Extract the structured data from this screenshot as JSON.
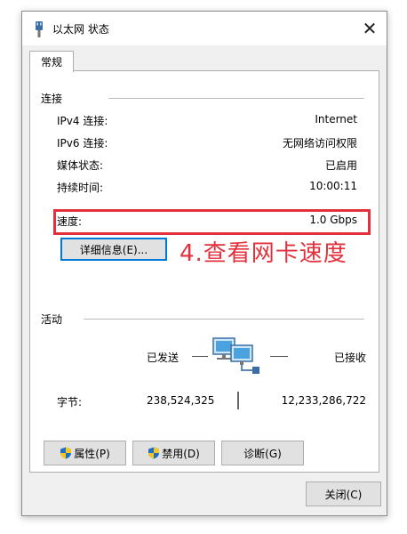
{
  "window": {
    "title": "以太网 状态",
    "close_glyph": "✕"
  },
  "tabs": [
    {
      "label": "常规"
    }
  ],
  "connection": {
    "group_label": "连接",
    "rows": [
      {
        "label": "IPv4 连接:",
        "value": "Internet"
      },
      {
        "label": "IPv6 连接:",
        "value": "无网络访问权限"
      },
      {
        "label": "媒体状态:",
        "value": "已启用"
      },
      {
        "label": "持续时间:",
        "value": "10:00:11"
      },
      {
        "label": "速度:",
        "value": "1.0 Gbps"
      }
    ],
    "details_button": "详细信息(E)..."
  },
  "annotation": {
    "text": "4.查看网卡速度",
    "color": "#e2313c"
  },
  "activity": {
    "group_label": "活动",
    "sent_label": "已发送",
    "received_label": "已接收",
    "bytes_label": "字节:",
    "bytes_sent": "238,524,325",
    "bytes_received": "12,233,286,722"
  },
  "actions": {
    "properties": "属性(P)",
    "disable": "禁用(D)",
    "diagnose": "诊断(G)"
  },
  "footer": {
    "close_button": "关闭(C)"
  },
  "icons": {
    "title": "ethernet-plug-icon",
    "network": "network-computers-icon",
    "shield": "uac-shield-icon"
  }
}
